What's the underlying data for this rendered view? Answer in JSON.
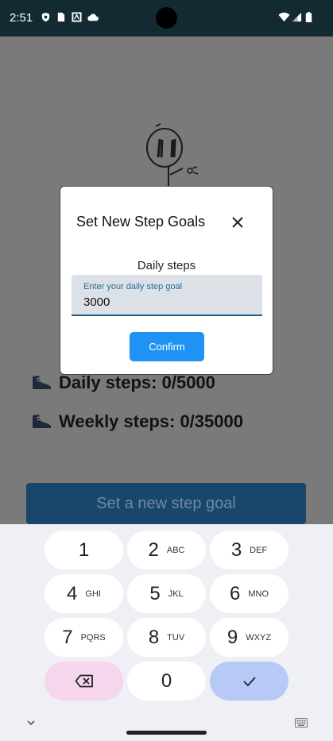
{
  "status_bar": {
    "time": "2:51",
    "icons": [
      "shield-icon",
      "sim-card-icon",
      "nfc-icon",
      "cloud-icon",
      "wifi-icon",
      "signal-icon",
      "battery-icon"
    ]
  },
  "background": {
    "daily_steps_text": "Daily steps: 0/5000",
    "weekly_steps_text": "Weekly steps: 0/35000",
    "set_goal_button": "Set a new step goal"
  },
  "dialog": {
    "title": "Set New Step Goals",
    "label": "Daily steps",
    "field_label": "Enter your daily step goal",
    "field_value": "3000",
    "confirm_label": "Confirm"
  },
  "keyboard": {
    "keys": [
      {
        "num": "1",
        "letters": ""
      },
      {
        "num": "2",
        "letters": "ABC"
      },
      {
        "num": "3",
        "letters": "DEF"
      },
      {
        "num": "4",
        "letters": "GHI"
      },
      {
        "num": "5",
        "letters": "JKL"
      },
      {
        "num": "6",
        "letters": "MNO"
      },
      {
        "num": "7",
        "letters": "PQRS"
      },
      {
        "num": "8",
        "letters": "TUV"
      },
      {
        "num": "9",
        "letters": "WXYZ"
      },
      {
        "num": "0",
        "letters": ""
      }
    ]
  },
  "colors": {
    "status_bar": "#132a33",
    "scrim": "#7a7a7a",
    "confirm": "#1e93f4",
    "goal_button": "#19466b",
    "delete_key": "#f6d6ec",
    "done_key": "#b7c9f7"
  }
}
